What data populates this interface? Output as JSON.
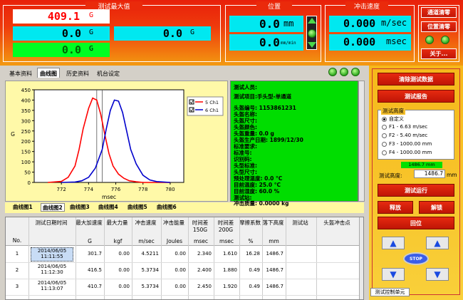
{
  "header": {
    "max_title": "测试最大值",
    "pos_title": "位置",
    "speed_title": "冲击速度",
    "max_value_1": "409.1",
    "max_unit_1": "G",
    "max_value_2": "0.0",
    "max_unit_2": "G",
    "max_value_3": "0.0",
    "max_unit_3": "G",
    "max_value_4": "0.0",
    "max_unit_4": "G",
    "pos_value": "0.0",
    "pos_unit": "mm",
    "pos_speed_value": "0.0",
    "pos_speed_unit": "mm/min",
    "speed_value": "0.000",
    "speed_unit": "m/sec",
    "time_value": "0.000",
    "time_unit": "msec",
    "btn_channel_reset": "通道清零",
    "btn_pos_reset": "位置清零",
    "btn_about": "关于..."
  },
  "tabs": [
    "基本资料",
    "曲线图",
    "历史资料",
    "机台设定"
  ],
  "chart_data": {
    "type": "line",
    "xlabel": "msec",
    "ylabel": "G",
    "ylim": [
      0,
      450
    ],
    "xlim": [
      770,
      781
    ],
    "xticks": [
      "772",
      "774",
      "776",
      "778",
      "780"
    ],
    "yticks": [
      "0",
      "50",
      "100",
      "150",
      "200",
      "250",
      "300",
      "350",
      "400",
      "450"
    ],
    "series": [
      {
        "name": "5 Ch1",
        "color": "#ff0000",
        "x": [
          771,
          772,
          772.5,
          773,
          773.3,
          773.6,
          774,
          774.3,
          774.6,
          774.9,
          775.2,
          775.5,
          775.8,
          776.2,
          776.6,
          777,
          777.5,
          778,
          779,
          780
        ],
        "y": [
          0,
          5,
          25,
          80,
          160,
          260,
          360,
          410,
          400,
          330,
          230,
          140,
          80,
          40,
          20,
          8,
          3,
          0,
          0,
          0
        ]
      },
      {
        "name": "6 Ch1",
        "color": "#0000cc",
        "x": [
          772,
          773,
          773.5,
          774,
          774.5,
          775,
          775.3,
          775.6,
          775.9,
          776.2,
          776.5,
          776.8,
          777.1,
          777.5,
          778,
          778.5,
          779,
          780
        ],
        "y": [
          0,
          2,
          8,
          25,
          70,
          160,
          260,
          350,
          400,
          395,
          340,
          250,
          160,
          90,
          35,
          12,
          4,
          0
        ]
      }
    ]
  },
  "info": [
    "测试人员:",
    "测试项目:手头型-单通道",
    "头盔编号: 1153861231",
    "头盔名称:",
    "头盔尺寸:",
    "头盔颜色:",
    "头盔重量: 0.0 g",
    "头盔生产日期: 1899/12/30",
    "标准要求:",
    "标准号:",
    "识别码:",
    "头型标准:",
    "头型尺寸:",
    "预处理温度: 0.0 °C",
    "目前温度: 25.0 °C",
    "目前湿度: 60.0 %",
    "测试站:",
    "冲击质量: 0.0000 kg"
  ],
  "curve_tabs": [
    "曲线图1",
    "曲线图2",
    "曲线图3",
    "曲线图4",
    "曲线图5",
    "曲线图6"
  ],
  "table": {
    "headers": [
      "No.",
      "测试日期时间",
      "最大加速度",
      "最大力量",
      "冲击速度",
      "冲击能量",
      "时间差150G",
      "时间差200G",
      "摩擦系数",
      "落下高度",
      "测试站",
      "头盔冲击点"
    ],
    "units": [
      "",
      "",
      "G",
      "kgf",
      "m/sec",
      "Joules",
      "msec",
      "msec",
      "%",
      "mm",
      "",
      ""
    ],
    "rows": [
      [
        "1",
        "2014/06/05 11:11:55",
        "301.7",
        "0.00",
        "4.5211",
        "0.00",
        "2.340",
        "1.610",
        "16.28",
        "1486.7"
      ],
      [
        "2",
        "2014/06/05 11:12:30",
        "416.5",
        "0.00",
        "5.3734",
        "0.00",
        "2.400",
        "1.880",
        "0.49",
        "1486.7"
      ],
      [
        "3",
        "2014/06/05 11:13:07",
        "410.7",
        "0.00",
        "5.3734",
        "0.00",
        "2.450",
        "1.920",
        "0.49",
        "1486.7"
      ]
    ]
  },
  "right": {
    "btn_clear": "清除测试数据",
    "btn_report": "测试报告",
    "height_group": "测试高度",
    "options": [
      "自定义",
      "F1 - 6.63 m/sec",
      "F2 - 5.40 m/sec",
      "F3 - 1000.00 mm",
      "F4 - 1000.00 mm"
    ],
    "height_readout": "1486.7 mm",
    "height_label": "测试高度:",
    "height_value": "1486.7",
    "height_unit": "mm",
    "btn_run": "测试运行",
    "btn_release": "释放",
    "btn_unlock": "解锁",
    "btn_return": "回位",
    "btn_stop": "STOP",
    "panel_title": "测试控制单元"
  }
}
